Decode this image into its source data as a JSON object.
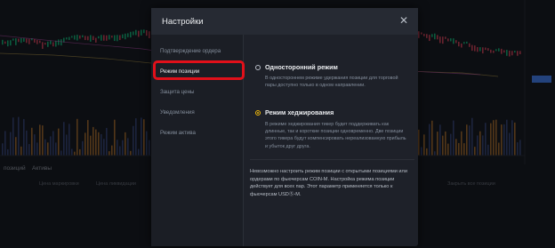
{
  "modal": {
    "title": "Настройки",
    "close_icon": "close-icon",
    "sidebar": [
      {
        "label": "Подтверждение ордера",
        "active": false
      },
      {
        "label": "Режим позиции",
        "active": true
      },
      {
        "label": "Защита цены",
        "active": false
      },
      {
        "label": "Уведомления",
        "active": false
      },
      {
        "label": "Режим актива",
        "active": false
      }
    ],
    "options": [
      {
        "title": "Односторонний режим",
        "desc": "В одностороннем режиме удержания позиции для торговой пары доступно только в одном направлении.",
        "selected": false
      },
      {
        "title": "Режим хеджирования",
        "desc": "В режиме хеджирования тикер будет поддерживать как длинные, так и короткие позиции одновременно. Две позиции этого тикера будут компенсировать нереализованную прибыль и убыток друг друга.",
        "selected": true
      }
    ],
    "note": "Невозможно настроить режим позиции с открытыми позициями или ордерами по фьючерсам COIN-M. Настройка режима позиции действует для всех пар. Этот параметр применяется только к фьючерсам USDⓈ-M."
  },
  "background": {
    "tabs": [
      "позиций",
      "Активы"
    ],
    "columns": [
      "Цена маркировки",
      "Цена ликвидации",
      "Закрыть все позиции"
    ]
  },
  "colors": {
    "accent": "#f0b90b",
    "highlight": "#e1101a",
    "up": "#0ecb81",
    "down": "#f6465d",
    "volume": "#c87a2a"
  }
}
